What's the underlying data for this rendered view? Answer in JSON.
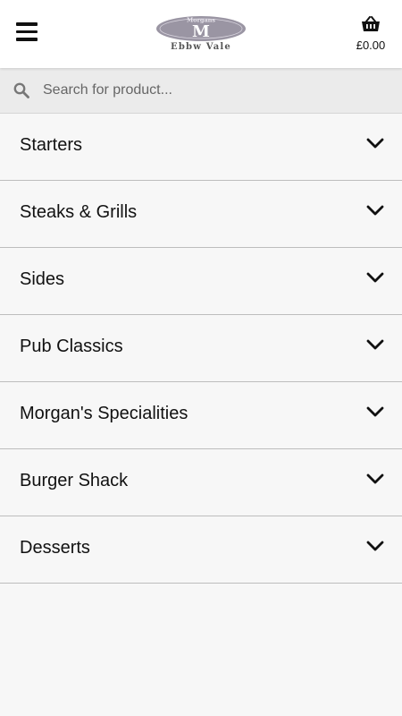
{
  "header": {
    "logo_top_text": "Morgans",
    "logo_letter": "M",
    "logo_bottom_text": "Ebbw Vale",
    "cart_total": "£0.00",
    "icons": {
      "menu": "hamburger-menu-icon",
      "cart": "shopping-basket-icon"
    }
  },
  "search": {
    "placeholder": "Search for product...",
    "value": "",
    "icon": "search-icon"
  },
  "categories": [
    {
      "label": "Starters"
    },
    {
      "label": "Steaks & Grills"
    },
    {
      "label": "Sides"
    },
    {
      "label": "Pub Classics"
    },
    {
      "label": "Morgan's Specialities"
    },
    {
      "label": "Burger Shack"
    },
    {
      "label": "Desserts"
    }
  ],
  "colors": {
    "background": "#f7f7f7",
    "header": "#ffffff",
    "search_bar": "#ebebeb",
    "divider": "#bdbdbd",
    "logo": "#9a95a3"
  }
}
